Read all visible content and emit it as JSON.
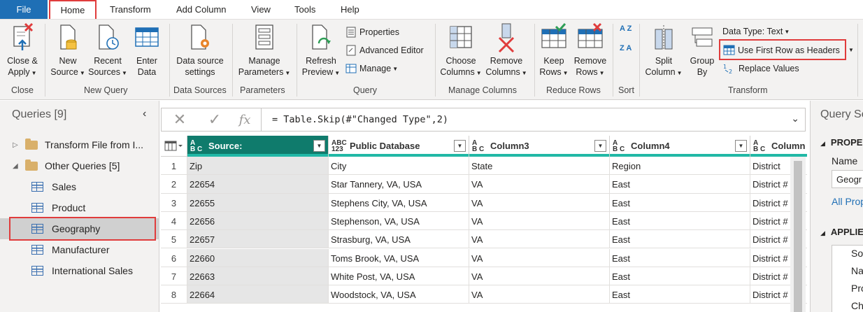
{
  "menu": {
    "file": "File",
    "tabs": [
      "Home",
      "Transform",
      "Add Column",
      "View",
      "Tools",
      "Help"
    ]
  },
  "ribbon": {
    "close": {
      "close_apply": [
        "Close &",
        "Apply"
      ],
      "group": "Close"
    },
    "new_query": {
      "new_source": [
        "New",
        "Source"
      ],
      "recent_sources": [
        "Recent",
        "Sources"
      ],
      "enter_data": [
        "Enter",
        "Data"
      ],
      "group": "New Query"
    },
    "data_sources": {
      "settings": [
        "Data source",
        "settings"
      ],
      "group": "Data Sources"
    },
    "parameters": {
      "manage": [
        "Manage",
        "Parameters"
      ],
      "group": "Parameters"
    },
    "query": {
      "refresh": [
        "Refresh",
        "Preview"
      ],
      "properties": "Properties",
      "advanced_editor": "Advanced Editor",
      "manage": "Manage",
      "group": "Query"
    },
    "manage_columns": {
      "choose": [
        "Choose",
        "Columns"
      ],
      "remove": [
        "Remove",
        "Columns"
      ],
      "group": "Manage Columns"
    },
    "reduce_rows": {
      "keep": [
        "Keep",
        "Rows"
      ],
      "remove": [
        "Remove",
        "Rows"
      ],
      "group": "Reduce Rows"
    },
    "sort": {
      "group": "Sort",
      "asc": "A Z",
      "desc": "Z A"
    },
    "transform": {
      "split": [
        "Split",
        "Column"
      ],
      "group_by": [
        "Group",
        "By"
      ],
      "data_type": "Data Type: Text",
      "first_row": "Use First Row as Headers",
      "replace": "Replace Values",
      "group": "Transform"
    }
  },
  "queries": {
    "title": "Queries [9]",
    "items": [
      {
        "label": "Transform File from I...",
        "type": "folder",
        "expanded": false
      },
      {
        "label": "Other Queries [5]",
        "type": "folder",
        "expanded": true
      },
      {
        "label": "Sales",
        "type": "table"
      },
      {
        "label": "Product",
        "type": "table"
      },
      {
        "label": "Geography",
        "type": "table",
        "selected": true
      },
      {
        "label": "Manufacturer",
        "type": "table"
      },
      {
        "label": "International Sales",
        "type": "table"
      }
    ]
  },
  "formula": {
    "cancel": "✕",
    "commit": "✓",
    "fx": "fx",
    "text": "= Table.Skip(#\"Changed Type\",2)"
  },
  "grid": {
    "columns": [
      {
        "type_top": "A",
        "type_bottom": "B C",
        "name": "Source:",
        "selected": true
      },
      {
        "type_top": "ABC",
        "type_bottom": "123",
        "name": "Public Database"
      },
      {
        "type_top": "A",
        "type_bottom": "B C",
        "name": "Column3"
      },
      {
        "type_top": "A",
        "type_bottom": "B C",
        "name": "Column4"
      },
      {
        "type_top": "A",
        "type_bottom": "B C",
        "name": "Column"
      }
    ],
    "rows": [
      {
        "n": "1",
        "cells": [
          "Zip",
          "City",
          "State",
          "Region",
          "District"
        ]
      },
      {
        "n": "2",
        "cells": [
          "22654",
          "Star Tannery, VA, USA",
          "VA",
          "East",
          "District #"
        ]
      },
      {
        "n": "3",
        "cells": [
          "22655",
          "Stephens City, VA, USA",
          "VA",
          "East",
          "District #"
        ]
      },
      {
        "n": "4",
        "cells": [
          "22656",
          "Stephenson, VA, USA",
          "VA",
          "East",
          "District #"
        ]
      },
      {
        "n": "5",
        "cells": [
          "22657",
          "Strasburg, VA, USA",
          "VA",
          "East",
          "District #"
        ]
      },
      {
        "n": "6",
        "cells": [
          "22660",
          "Toms Brook, VA, USA",
          "VA",
          "East",
          "District #"
        ]
      },
      {
        "n": "7",
        "cells": [
          "22663",
          "White Post, VA, USA",
          "VA",
          "East",
          "District #"
        ]
      },
      {
        "n": "8",
        "cells": [
          "22664",
          "Woodstock, VA, USA",
          "VA",
          "East",
          "District #"
        ]
      }
    ]
  },
  "settings": {
    "title": "Query Se",
    "properties": "PROPE",
    "name_label": "Name",
    "name_value": "Geogr",
    "all_props": "All Prop",
    "applied": "APPLIE",
    "steps": [
      "So",
      "Na",
      "Pro",
      "Ch"
    ]
  },
  "colors": {
    "accent": "#0f7b6c",
    "file_tab": "#1f6fb5",
    "highlight": "#e03c3c",
    "type_bar": "#21b8a6"
  }
}
